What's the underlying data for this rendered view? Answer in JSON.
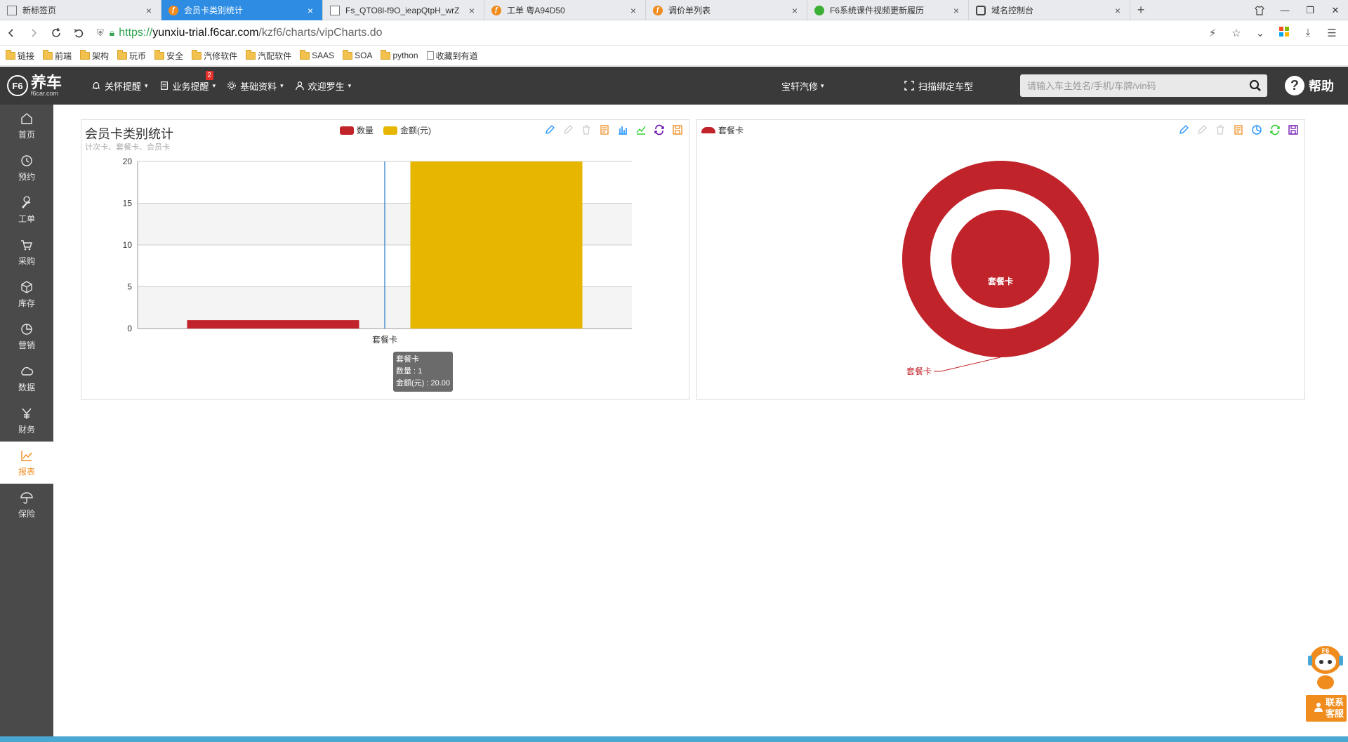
{
  "browser": {
    "tabs": [
      {
        "label": "新标签页",
        "icon": "grid-icon",
        "active": false
      },
      {
        "label": "会员卡类别统计",
        "icon": "f6-logo-icon",
        "active": true
      },
      {
        "label": "Fs_QTO8l-f9O_ieapQtpH_wrZ",
        "icon": "document-icon",
        "active": false
      },
      {
        "label": "工单 粤A94D50",
        "icon": "f6-logo-icon",
        "active": false
      },
      {
        "label": "调价单列表",
        "icon": "f6-logo-icon",
        "active": false
      },
      {
        "label": "F6系统课件视频更新履历",
        "icon": "wechat-icon",
        "active": false
      },
      {
        "label": "域名控制台",
        "icon": "link-icon",
        "active": false
      }
    ],
    "url_scheme": "https://",
    "url_host": "yunxiu-trial.f6car.com",
    "url_path": "/kzf6/charts/vipCharts.do",
    "bookmarks": [
      "链接",
      "前端",
      "架构",
      "玩币",
      "安全",
      "汽修软件",
      "汽配软件",
      "SAAS",
      "SOA",
      "python",
      "收藏到有道"
    ]
  },
  "header": {
    "logo_name": "养车",
    "logo_sub": "f6car.com",
    "logo_mark": "F6",
    "menus": [
      {
        "label": "关怀提醒",
        "icon": "bell-icon"
      },
      {
        "label": "业务提醒",
        "icon": "clipboard-icon",
        "badge": "2"
      },
      {
        "label": "基础资料",
        "icon": "gear-icon"
      },
      {
        "label": "欢迎罗生",
        "icon": "user-icon"
      }
    ],
    "store": "宝轩汽修",
    "scan_label": "扫描绑定车型",
    "search_placeholder": "请输入车主姓名/手机/车牌/vin码",
    "help_label": "帮助"
  },
  "sidebar": {
    "items": [
      {
        "label": "首页",
        "icon": "home-icon",
        "active": false
      },
      {
        "label": "预约",
        "icon": "clock-icon",
        "active": false
      },
      {
        "label": "工单",
        "icon": "wrench-icon",
        "active": false
      },
      {
        "label": "采购",
        "icon": "cart-icon",
        "active": false
      },
      {
        "label": "库存",
        "icon": "box-icon",
        "active": false
      },
      {
        "label": "营销",
        "icon": "pie-icon",
        "active": false
      },
      {
        "label": "数据",
        "icon": "cloud-icon",
        "active": false
      },
      {
        "label": "财务",
        "icon": "yen-icon",
        "active": false
      },
      {
        "label": "报表",
        "icon": "line-chart-icon",
        "active": true
      },
      {
        "label": "保险",
        "icon": "umbrella-icon",
        "active": false
      }
    ]
  },
  "colors": {
    "series_count": "#c1232b",
    "series_amount": "#e6b600",
    "active": "#f08c1e",
    "header_bg": "#3a3a3a",
    "sidebar_bg": "#4a4a4a"
  },
  "bar_panel": {
    "title": "会员卡类别统计",
    "subtitle": "计次卡、套餐卡、会员卡",
    "tooltip": {
      "title": "套餐卡",
      "line1": "数量 : 1",
      "line2": "金额(元) : 20.00"
    }
  },
  "chart_data": [
    {
      "type": "bar",
      "title": "会员卡类别统计",
      "subtitle": "计次卡、套餐卡、会员卡",
      "categories": [
        "套餐卡"
      ],
      "series": [
        {
          "name": "数量",
          "values": [
            1
          ],
          "color": "#c1232b"
        },
        {
          "name": "金额(元)",
          "values": [
            20
          ],
          "color": "#e6b600"
        }
      ],
      "ylim": [
        0,
        20
      ],
      "yticks": [
        0,
        5,
        10,
        15,
        20
      ],
      "legend": "top-center",
      "grid": true
    },
    {
      "type": "pie",
      "legend": [
        "套餐卡"
      ],
      "series": [
        {
          "name": "inner",
          "slices": [
            {
              "label": "套餐卡",
              "value": 1
            }
          ]
        },
        {
          "name": "outer",
          "slices": [
            {
              "label": "套餐卡",
              "value": 20
            }
          ]
        }
      ],
      "color": "#c1232b",
      "legend_position": "top-left"
    }
  ],
  "mascot": {
    "badge": "F6",
    "contact_line1": "联系",
    "contact_line2": "客服"
  }
}
